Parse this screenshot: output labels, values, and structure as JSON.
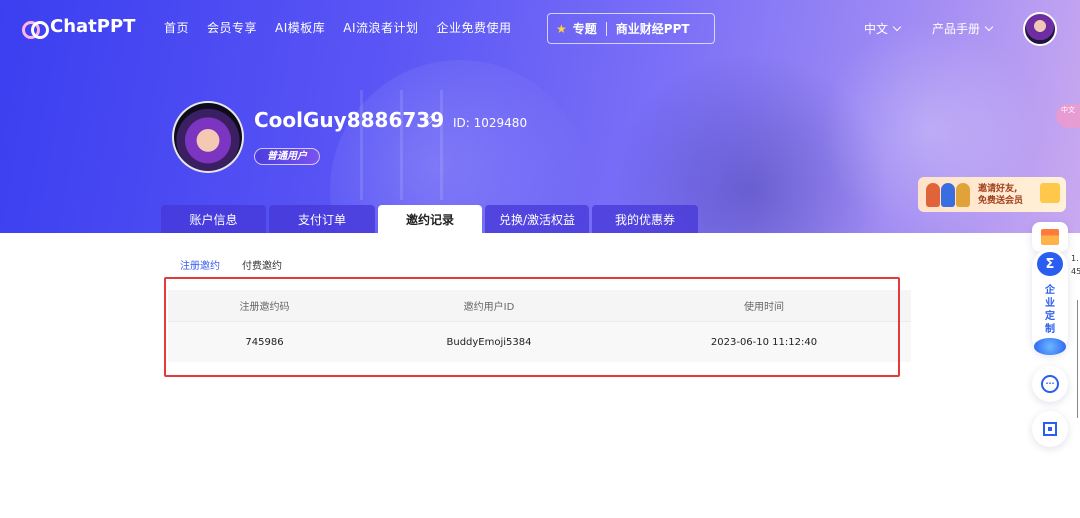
{
  "nav": {
    "logo": "ChatPPT",
    "items": [
      "首页",
      "会员专享",
      "AI模板库",
      "AI流浪者计划",
      "企业免费使用"
    ],
    "topic_label": "专题",
    "topic_value": "商业财经PPT",
    "language": "中文",
    "manual": "产品手册"
  },
  "profile": {
    "username": "CoolGuy8886739",
    "id_label": "ID: 1029480",
    "badge": "普通用户"
  },
  "tabs": [
    "账户信息",
    "支付订单",
    "邀约记录",
    "兑换/激活权益",
    "我的优惠券"
  ],
  "promo": {
    "line1": "邀请好友,",
    "line2": "免费送会员"
  },
  "side_pill": "中文",
  "subtabs": [
    "注册邀约",
    "付费邀约"
  ],
  "table": {
    "headers": [
      "注册邀约码",
      "邀约用户ID",
      "使用时间"
    ],
    "rows": [
      [
        "745986",
        "BuddyEmoji5384",
        "2023-06-10 11:12:40"
      ]
    ]
  },
  "widgets": {
    "enterprise_text": "企业定制",
    "side_num_1": "1.",
    "side_num_2": "45"
  },
  "colors": {
    "accent": "#3a5cf0",
    "highlight": "#e23b3b",
    "hero_start": "#3b3ff0",
    "hero_end": "#c9a9f0"
  }
}
